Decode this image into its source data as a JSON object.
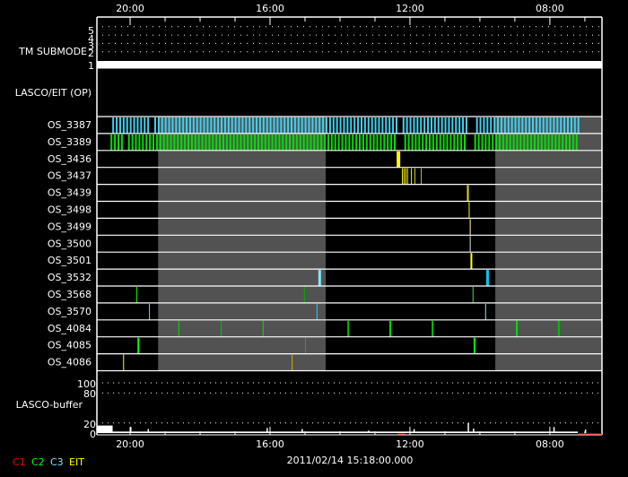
{
  "chart_data": {
    "type": "timeline",
    "title": "",
    "date_label": "2011/02/14 15:18:00.000",
    "time_axis": {
      "unit": "hours",
      "range": [
        20.95,
        6.51
      ],
      "major_ticks": [
        20,
        16,
        12,
        8
      ],
      "major_labels": [
        "20:00",
        "16:00",
        "12:00",
        "08:00"
      ],
      "minor_step": 1
    },
    "shaded_periods": [
      [
        19.2,
        14.41
      ],
      [
        9.56,
        6.51
      ]
    ],
    "submode_panel": {
      "label": "TM SUBMODE",
      "y_ticks": [
        "1",
        "2",
        "3",
        "4",
        "5"
      ],
      "value": 1
    },
    "op_panel": {
      "label": "LASCO/EIT (OP)"
    },
    "rows": [
      {
        "name": "OS_3387",
        "dense": {
          "start": 20.51,
          "end": 7.18,
          "cadence": 0.1,
          "color": "#40d0f0",
          "gaps": [
            [
              19.49,
              19.38
            ],
            [
              12.38,
              12.21
            ],
            [
              10.38,
              10.15
            ]
          ]
        },
        "events": []
      },
      {
        "name": "OS_3389",
        "dense": {
          "start": 20.56,
          "end": 7.18,
          "cadence": 0.1,
          "color": "#00e000",
          "gaps": [
            [
              20.23,
              20.15
            ],
            [
              12.4,
              12.25
            ],
            [
              10.4,
              10.2
            ]
          ]
        },
        "events": []
      },
      {
        "name": "OS_3436",
        "events": [
          {
            "t": 12.38,
            "color": "#ffff00",
            "w": 4
          }
        ]
      },
      {
        "name": "OS_3437",
        "events": [
          {
            "t": 12.23,
            "color": "#ffff00",
            "w": 1
          },
          {
            "t": 12.18,
            "color": "#ffff00",
            "w": 1
          },
          {
            "t": 12.13,
            "color": "#ffff00",
            "w": 1
          },
          {
            "t": 12.08,
            "color": "#e0e000",
            "w": 1
          },
          {
            "t": 11.97,
            "color": "#ffff00",
            "w": 1
          },
          {
            "t": 11.87,
            "color": "#d0d000",
            "w": 1
          },
          {
            "t": 11.69,
            "color": "#c0c000",
            "w": 1
          }
        ]
      },
      {
        "name": "OS_3439",
        "events": [
          {
            "t": 10.37,
            "color": "#e0e000",
            "w": 2
          }
        ]
      },
      {
        "name": "OS_3498",
        "events": [
          {
            "t": 10.32,
            "color": "#ffff00",
            "w": 1
          }
        ]
      },
      {
        "name": "OS_3499",
        "events": [
          {
            "t": 10.29,
            "color": "#ffffa0",
            "w": 1
          }
        ]
      },
      {
        "name": "OS_3500",
        "events": [
          {
            "t": 10.29,
            "color": "#e0e0e0",
            "w": 1
          }
        ]
      },
      {
        "name": "OS_3501",
        "events": [
          {
            "t": 10.27,
            "color": "#ffff00",
            "w": 2
          }
        ]
      },
      {
        "name": "OS_3532",
        "events": [
          {
            "t": 14.62,
            "color": "#80e8f8",
            "w": 3
          },
          {
            "t": 9.82,
            "color": "#00c8f0",
            "w": 3
          }
        ]
      },
      {
        "name": "OS_3568",
        "events": [
          {
            "t": 19.82,
            "color": "#00ff00",
            "w": 1
          },
          {
            "t": 15.03,
            "color": "#00b000",
            "w": 1
          },
          {
            "t": 10.21,
            "color": "#40e040",
            "w": 1
          }
        ]
      },
      {
        "name": "OS_3570",
        "events": [
          {
            "t": 19.46,
            "color": "#80d0ff",
            "w": 1
          },
          {
            "t": 14.67,
            "color": "#40c0f0",
            "w": 1
          },
          {
            "t": 9.85,
            "color": "#a0e0f0",
            "w": 1
          }
        ]
      },
      {
        "name": "OS_4084",
        "events": [
          {
            "t": 18.62,
            "color": "#00e000",
            "w": 1
          },
          {
            "t": 17.41,
            "color": "#00c000",
            "w": 1
          },
          {
            "t": 16.21,
            "color": "#00e000",
            "w": 1
          },
          {
            "t": 13.79,
            "color": "#00c000",
            "w": 2
          },
          {
            "t": 12.59,
            "color": "#00e000",
            "w": 2
          },
          {
            "t": 11.38,
            "color": "#00c000",
            "w": 2
          },
          {
            "t": 8.97,
            "color": "#00e000",
            "w": 2
          },
          {
            "t": 7.77,
            "color": "#00c000",
            "w": 2
          }
        ]
      },
      {
        "name": "OS_4085",
        "events": [
          {
            "t": 19.79,
            "color": "#00ff00",
            "w": 2
          },
          {
            "t": 15.0,
            "color": "#00c000",
            "w": 1
          },
          {
            "t": 10.18,
            "color": "#00ff00",
            "w": 2
          }
        ]
      },
      {
        "name": "OS_4086",
        "events": [
          {
            "t": 20.2,
            "color": "#ffff00",
            "w": 1
          },
          {
            "t": 15.38,
            "color": "#d0b000",
            "w": 1
          }
        ]
      }
    ],
    "buffer_panel": {
      "label": "LASCO-buffer",
      "y_ticks": [
        0,
        20,
        80,
        100
      ],
      "y_range": [
        0,
        105
      ],
      "gridlines": [
        20,
        80,
        100
      ],
      "baseline": 3,
      "start_block": {
        "t0": 20.95,
        "t1": 20.5,
        "value": 15
      },
      "data_end": 7.2,
      "spikes": [
        [
          20.0,
          12
        ],
        [
          19.5,
          8
        ],
        [
          16.1,
          10
        ],
        [
          15.1,
          8
        ],
        [
          13.2,
          5
        ],
        [
          11.9,
          8
        ],
        [
          10.35,
          20
        ],
        [
          10.2,
          9
        ],
        [
          7.9,
          12
        ],
        [
          7.0,
          7
        ]
      ],
      "c1_line_ranges": [
        [
          12.35,
          12.12
        ],
        [
          7.2,
          6.51
        ]
      ]
    },
    "legend": [
      {
        "label": "C1",
        "color": "#ff0000"
      },
      {
        "label": "C2",
        "color": "#00ff00"
      },
      {
        "label": "C3",
        "color": "#80e0ff"
      },
      {
        "label": "EIT",
        "color": "#ffff00"
      }
    ]
  }
}
